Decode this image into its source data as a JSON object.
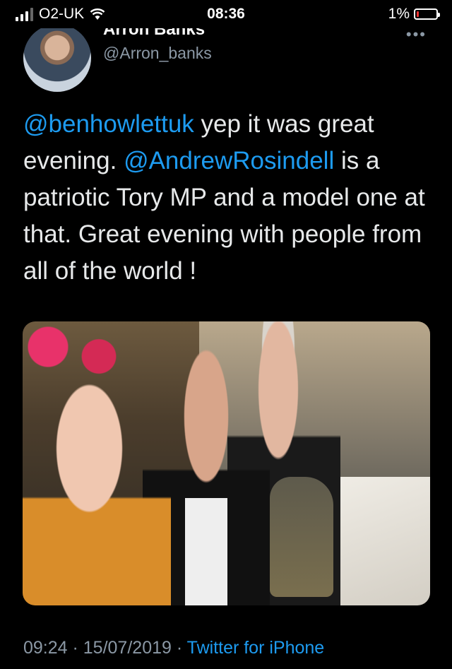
{
  "status_bar": {
    "carrier": "O2-UK",
    "time": "08:36",
    "battery_percent": "1%",
    "battery_level": 0.01,
    "icons": [
      "signal-icon",
      "wifi-icon",
      "battery-icon"
    ]
  },
  "tweet": {
    "author_name": "Arron Banks",
    "author_handle": "@Arron_banks",
    "more_label": "•••",
    "text_parts": {
      "mention1": "@benhowlettuk",
      "text1": " yep it was great evening. ",
      "mention2": "@AndrewRosindell",
      "text2": " is a patriotic Tory MP and a model one at that. Great evening with people from all of the world !"
    },
    "timestamp": "09:24 · 15/07/2019 · ",
    "source": "Twitter for iPhone"
  },
  "colors": {
    "background": "#000000",
    "text": "#e7e9ea",
    "link": "#1d9bf0",
    "secondary": "#8b98a5"
  }
}
